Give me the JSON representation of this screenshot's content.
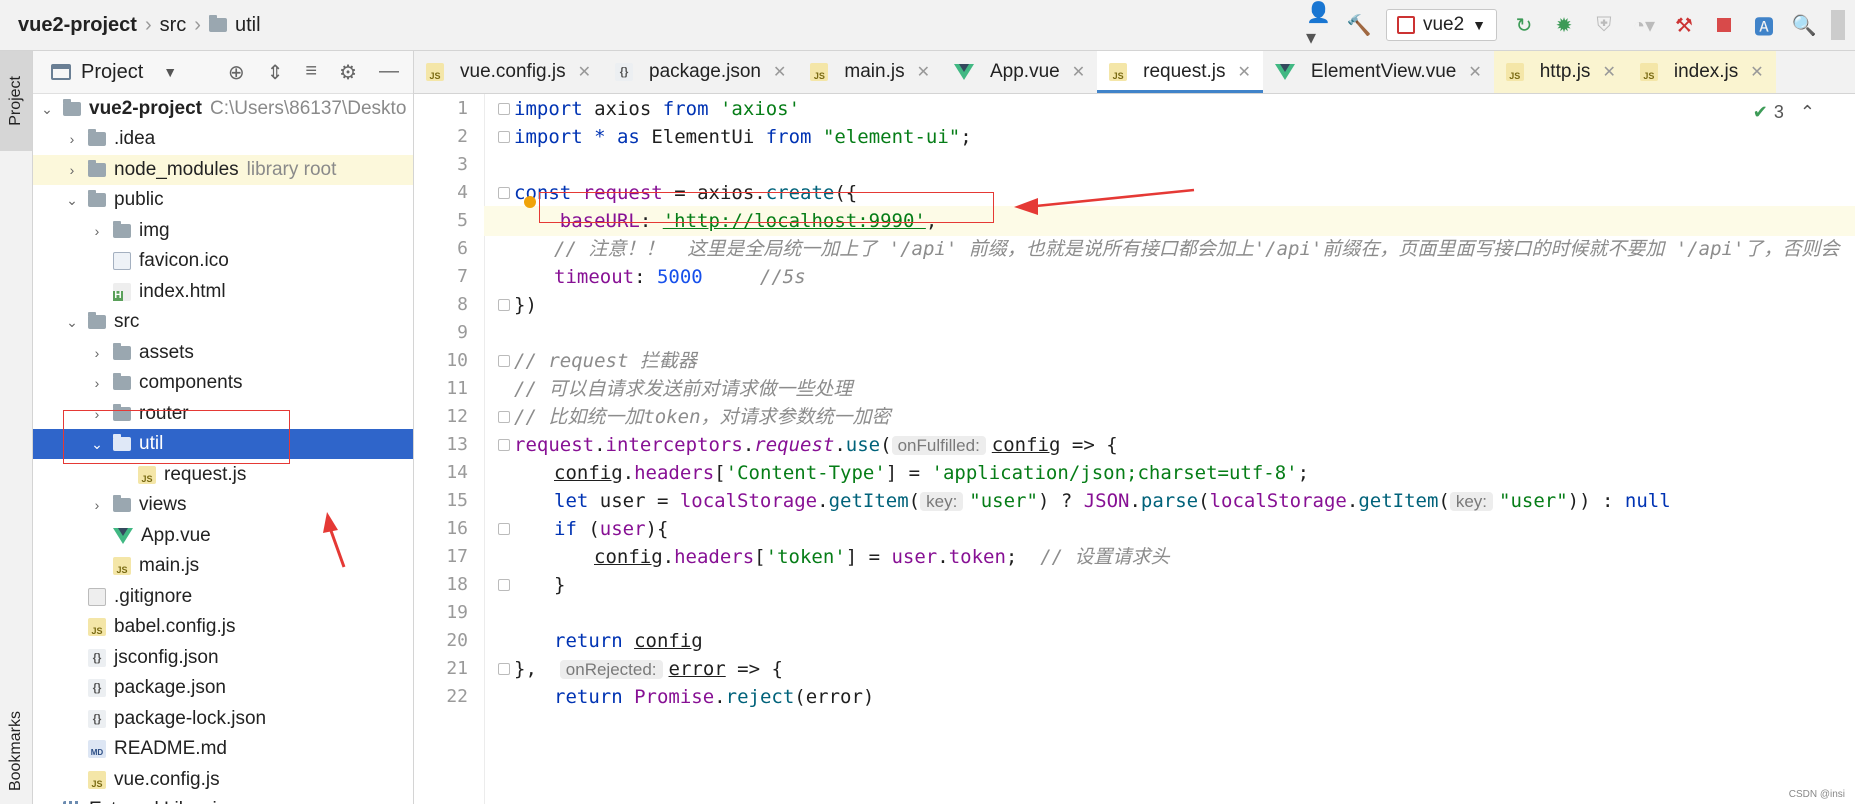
{
  "navbar": {
    "project": "vue2-project",
    "crumbs": [
      "src",
      "util"
    ],
    "run_config": "vue2"
  },
  "left_strip": {
    "project_tab": "Project",
    "bookmarks_tab": "Bookmarks"
  },
  "project_panel": {
    "title": "Project",
    "root": {
      "name": "vue2-project",
      "path": "C:\\Users\\86137\\Deskto"
    },
    "rows": [
      {
        "name": ".idea",
        "type": "folder",
        "suffix": ""
      },
      {
        "name": "node_modules",
        "type": "folder",
        "suffix": "library root"
      },
      {
        "name": "public",
        "type": "folder",
        "suffix": ""
      },
      {
        "name": "img",
        "type": "folder",
        "suffix": ""
      },
      {
        "name": "favicon.ico",
        "type": "ico",
        "suffix": ""
      },
      {
        "name": "index.html",
        "type": "html",
        "suffix": ""
      },
      {
        "name": "src",
        "type": "folder",
        "suffix": ""
      },
      {
        "name": "assets",
        "type": "folder",
        "suffix": ""
      },
      {
        "name": "components",
        "type": "folder",
        "suffix": ""
      },
      {
        "name": "router",
        "type": "folder",
        "suffix": ""
      },
      {
        "name": "util",
        "type": "folder",
        "suffix": ""
      },
      {
        "name": "request.js",
        "type": "js",
        "suffix": ""
      },
      {
        "name": "views",
        "type": "folder",
        "suffix": ""
      },
      {
        "name": "App.vue",
        "type": "vue",
        "suffix": ""
      },
      {
        "name": "main.js",
        "type": "js",
        "suffix": ""
      },
      {
        "name": ".gitignore",
        "type": "git",
        "suffix": ""
      },
      {
        "name": "babel.config.js",
        "type": "js",
        "suffix": ""
      },
      {
        "name": "jsconfig.json",
        "type": "json",
        "suffix": ""
      },
      {
        "name": "package.json",
        "type": "json",
        "suffix": ""
      },
      {
        "name": "package-lock.json",
        "type": "json",
        "suffix": ""
      },
      {
        "name": "README.md",
        "type": "md",
        "suffix": ""
      },
      {
        "name": "vue.config.js",
        "type": "js",
        "suffix": ""
      },
      {
        "name": "External Libraries",
        "type": "lib",
        "suffix": ""
      }
    ]
  },
  "tabs": [
    "vue.config.js",
    "package.json",
    "main.js",
    "App.vue",
    "request.js",
    "ElementView.vue",
    "http.js",
    "index.js"
  ],
  "editor": {
    "inspection_count": "3",
    "line_numbers": [
      "1",
      "2",
      "3",
      "4",
      "5",
      "6",
      "7",
      "8",
      "9",
      "10",
      "11",
      "12",
      "13",
      "14",
      "15",
      "16",
      "17",
      "18",
      "19",
      "20",
      "21",
      "22"
    ],
    "line1": [
      "import",
      "axios",
      "from",
      "'axios'"
    ],
    "line2": [
      "import",
      "* as",
      "ElementUi",
      "from",
      "\"element-ui\"",
      ";"
    ],
    "line4": [
      "const",
      "request",
      "= axios.",
      "create",
      "({"
    ],
    "line5": [
      "baseURL",
      ": ",
      "'http://localhost:9990'",
      ","
    ],
    "line6": "// 注意！！  这里是全局统一加上了 '/api' 前缀，也就是说所有接口都会加上'/api'前缀在，页面里面写接口的时候就不要加 '/api'了，否则会",
    "line7": [
      "timeout",
      ": ",
      "5000",
      "     //5s"
    ],
    "line8": "})",
    "line10": "// request 拦截器",
    "line11": "// 可以自请求发送前对请求做一些处理",
    "line12": "// 比如统一加token，对请求参数统一加密",
    "line13": [
      "request",
      ".",
      "interceptors",
      ".",
      "request",
      ".",
      "use",
      "(",
      "onFulfilled:",
      "config",
      " => {"
    ],
    "line14": [
      "config",
      ".",
      "headers",
      "[",
      "'Content-Type'",
      "] = ",
      "'application/json;charset=utf-8'",
      ";"
    ],
    "line15": [
      "let",
      " user = ",
      "localStorage",
      ".",
      "getItem",
      "(",
      "key:",
      "\"user\"",
      ") ? ",
      "JSON",
      ".",
      "parse",
      "(",
      "localStorage",
      ".",
      "getItem",
      "(",
      "key:",
      "\"user\"",
      ")) : ",
      "null"
    ],
    "line16": [
      "if",
      " (",
      "user",
      "){"
    ],
    "line17": [
      "config",
      ".",
      "headers",
      "[",
      "'token'",
      "] = ",
      "user",
      ".",
      "token",
      ";  ",
      "// 设置请求头"
    ],
    "line18": "}",
    "line20": [
      "return",
      "config"
    ],
    "line21": [
      "},",
      "onRejected:",
      "error",
      " => {"
    ],
    "line22": [
      "return",
      "Promise",
      ".",
      "reject",
      "(error)"
    ]
  },
  "watermark": "CSDN @insi"
}
